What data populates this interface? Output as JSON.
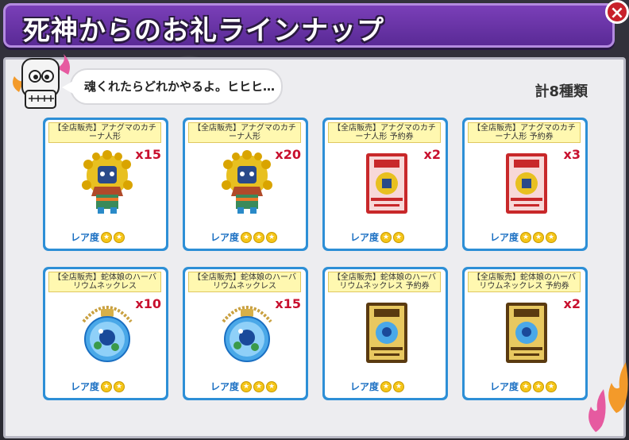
{
  "header": {
    "title": "死神からのお礼ラインナップ",
    "close": "×"
  },
  "speech": "魂くれたらどれかやるよ。ヒヒヒ…",
  "total": "計8種類",
  "colors": {
    "header": "#6a34a8",
    "card_border": "#2d8fd6",
    "qty": "#c8102e",
    "rarity": "#1a6fc2",
    "star": "#f5c518"
  },
  "rarity_label": "レア度",
  "items": [
    {
      "name": "【全店販売】アナグマのカチーナ人形",
      "qty": "x15",
      "stars": 2,
      "art": "kachina-doll"
    },
    {
      "name": "【全店販売】アナグマのカチーナ人形",
      "qty": "x20",
      "stars": 3,
      "art": "kachina-doll"
    },
    {
      "name": "【全店販売】アナグマのカチーナ人形 予約券",
      "qty": "x2",
      "stars": 2,
      "art": "red-ticket"
    },
    {
      "name": "【全店販売】アナグマのカチーナ人形 予約券",
      "qty": "x3",
      "stars": 3,
      "art": "red-ticket"
    },
    {
      "name": "【全店販売】蛇体娘のハーバリウムネックレス",
      "qty": "x10",
      "stars": 2,
      "art": "herbarium-necklace"
    },
    {
      "name": "【全店販売】蛇体娘のハーバリウムネックレス",
      "qty": "x15",
      "stars": 3,
      "art": "herbarium-necklace"
    },
    {
      "name": "【全店販売】蛇体娘のハーバリウムネックレス 予約券",
      "qty": "",
      "stars": 2,
      "art": "gold-ticket"
    },
    {
      "name": "【全店販売】蛇体娘のハーバリウムネックレス 予約券",
      "qty": "x2",
      "stars": 3,
      "art": "gold-ticket"
    }
  ]
}
